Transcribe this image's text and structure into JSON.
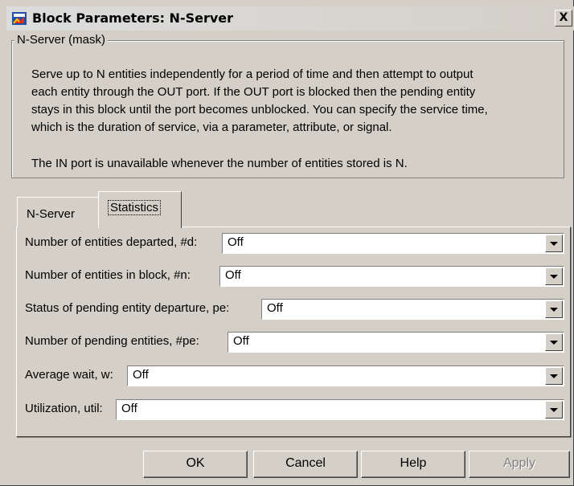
{
  "window": {
    "title": "Block Parameters: N-Server",
    "close_label": "X"
  },
  "description": {
    "legend": "N-Server (mask)",
    "lines": [
      "Serve up to N entities independently for a period of time and then attempt to output",
      "each entity through the OUT port. If the OUT port is blocked then the pending entity",
      "stays in this block until the port becomes unblocked. You can specify the service time,",
      "which is the duration of service, via a parameter, attribute, or signal."
    ],
    "note": "The IN port is unavailable whenever the number of entities stored is N."
  },
  "tabs": [
    {
      "label": "N-Server",
      "active": false
    },
    {
      "label": "Statistics",
      "active": true
    }
  ],
  "fields": [
    {
      "label": "Number of entities departed, #d:",
      "value": "Off"
    },
    {
      "label": "Number of entities in block, #n:",
      "value": "Off"
    },
    {
      "label": "Status of pending entity departure, pe:",
      "value": "Off"
    },
    {
      "label": "Number of pending entities, #pe:",
      "value": "Off"
    },
    {
      "label": "Average wait, w:",
      "value": "Off"
    },
    {
      "label": "Utilization, util:",
      "value": "Off"
    }
  ],
  "buttons": {
    "ok": "OK",
    "cancel": "Cancel",
    "help": "Help",
    "apply": "Apply"
  },
  "icons": {
    "title": "simulink-block-icon",
    "dropdown": "chevron-down-icon"
  }
}
